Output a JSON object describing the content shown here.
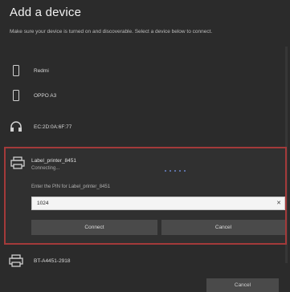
{
  "dialog": {
    "title": "Add a device",
    "subtitle": "Make sure your device is turned on and discoverable. Select a device below to connect."
  },
  "devices": [
    {
      "name": "Redmi",
      "icon": "phone-icon"
    },
    {
      "name": "OPPO A3",
      "icon": "phone-icon"
    },
    {
      "name": "EC:2D:0A:6F:77",
      "icon": "headphones-icon"
    }
  ],
  "selected_device": {
    "name": "Label_printer_8451",
    "status": "Connecting...",
    "icon": "printer-icon",
    "pin_label": "Enter the PIN for Label_printer_8451",
    "pin_value": "1024",
    "connect_label": "Connect",
    "cancel_label": "Cancel"
  },
  "other_devices": [
    {
      "name": "BT-A4451-2918",
      "icon": "printer-icon"
    }
  ],
  "footer": {
    "cancel_label": "Cancel"
  },
  "colors": {
    "background": "#2b2b2b",
    "selection_border": "#a33a3a",
    "button": "#4a4a4a"
  }
}
